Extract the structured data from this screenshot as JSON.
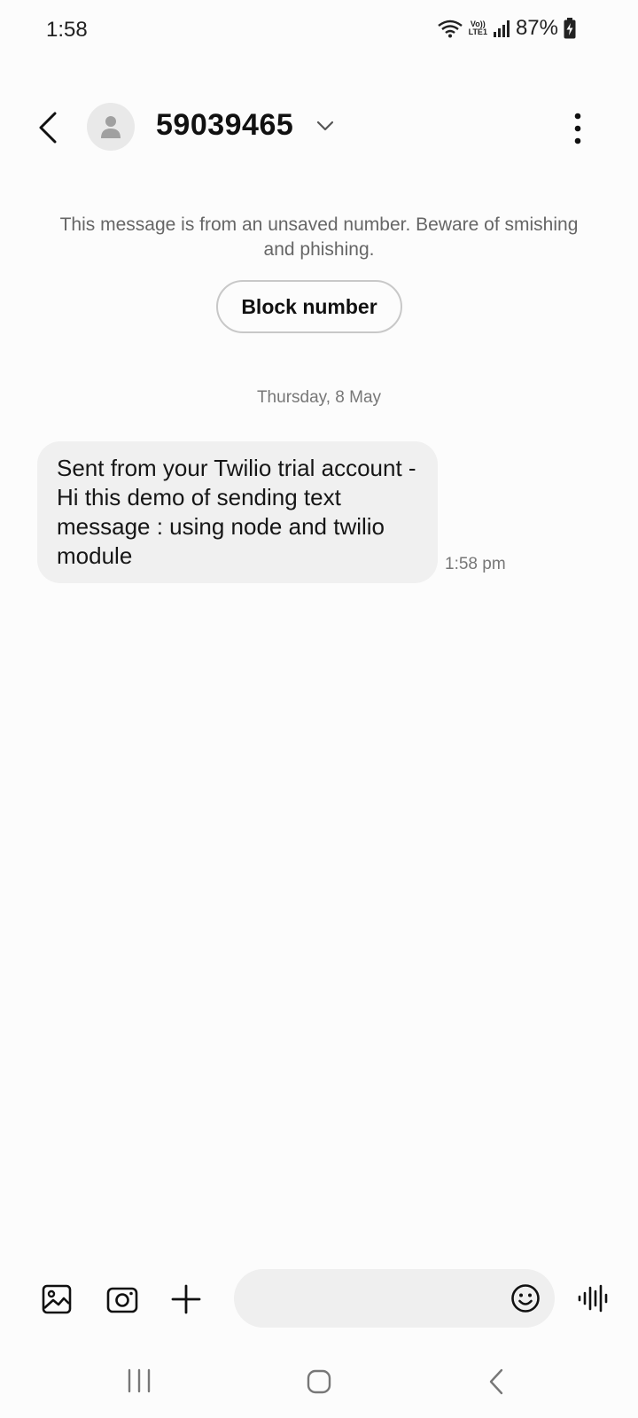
{
  "status_bar": {
    "time": "1:58",
    "volte_top": "Vo))",
    "volte_bottom": "LTE1",
    "battery": "87%"
  },
  "header": {
    "contact_name": "59039465",
    "icons": [
      "back-icon",
      "avatar-person-icon",
      "chevron-down-icon",
      "more-vert-icon"
    ]
  },
  "warning": {
    "text": "This message is from an unsaved number. Beware of smishing and phishing.",
    "block_label": "Block number"
  },
  "conversation": {
    "date": "Thursday, 8 May",
    "messages": [
      {
        "text": "Sent from your Twilio trial account - Hi this demo of sending text message : using node and twilio module",
        "time": "1:58 pm"
      }
    ]
  },
  "compose": {
    "placeholder": "",
    "icons": [
      "gallery-icon",
      "camera-icon",
      "plus-icon",
      "emoji-icon",
      "voice-wave-icon"
    ]
  },
  "colors": {
    "background": "#fcfcfc",
    "bubble": "#f0f0f0",
    "muted_text": "#666666"
  }
}
